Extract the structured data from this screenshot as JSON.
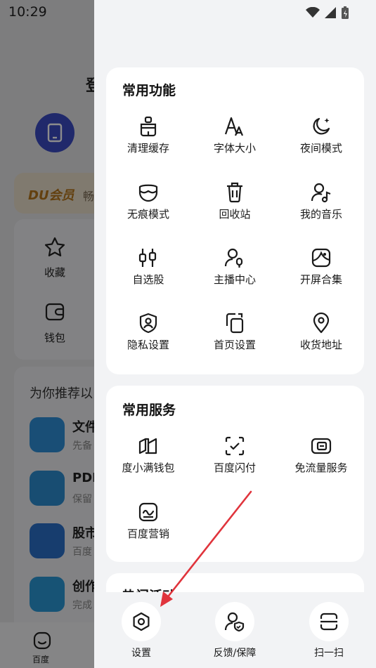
{
  "status": {
    "time": "10:29"
  },
  "background": {
    "title": "登",
    "vip_logo": "DU会员",
    "vip_text": "畅",
    "quick": [
      {
        "label": "收藏",
        "icon": "star-icon"
      },
      {
        "label": "钱包",
        "icon": "wallet-icon"
      }
    ],
    "recommend_title": "为你推荐以",
    "apps": [
      {
        "title": "文件",
        "sub": "先备"
      },
      {
        "title": "PDF",
        "sub": "保留"
      },
      {
        "title": "股市",
        "sub": "百度"
      },
      {
        "title": "创作",
        "sub": "完成"
      }
    ],
    "nav_home_label": "百度"
  },
  "common_functions": {
    "title": "常用功能",
    "items": [
      {
        "label": "清理缓存",
        "icon": "broom-clean-icon"
      },
      {
        "label": "字体大小",
        "icon": "font-size-icon"
      },
      {
        "label": "夜间模式",
        "icon": "moon-icon"
      },
      {
        "label": "无痕模式",
        "icon": "mask-icon"
      },
      {
        "label": "回收站",
        "icon": "trash-icon"
      },
      {
        "label": "我的音乐",
        "icon": "music-user-icon"
      },
      {
        "label": "自选股",
        "icon": "sliders-icon"
      },
      {
        "label": "主播中心",
        "icon": "anchor-mic-icon"
      },
      {
        "label": "开屏合集",
        "icon": "image-collection-icon"
      },
      {
        "label": "隐私设置",
        "icon": "privacy-shield-icon"
      },
      {
        "label": "首页设置",
        "icon": "homepage-settings-icon"
      },
      {
        "label": "收货地址",
        "icon": "location-pin-icon"
      }
    ]
  },
  "common_services": {
    "title": "常用服务",
    "items": [
      {
        "label": "度小满钱包",
        "icon": "wallet-fold-icon"
      },
      {
        "label": "百度闪付",
        "icon": "scan-check-icon"
      },
      {
        "label": "免流量服务",
        "icon": "data-card-icon"
      },
      {
        "label": "百度营销",
        "icon": "marketing-chart-icon"
      }
    ]
  },
  "hot_activities": {
    "title": "热门活动"
  },
  "bottom_bar": [
    {
      "label": "设置",
      "icon": "settings-gear-icon"
    },
    {
      "label": "反馈/保障",
      "icon": "feedback-shield-icon"
    },
    {
      "label": "扫一扫",
      "icon": "scan-icon"
    }
  ],
  "colors": {
    "annotation_arrow": "#e0343c",
    "panel_bg": "#f2f3f5",
    "card_bg": "#ffffff"
  }
}
